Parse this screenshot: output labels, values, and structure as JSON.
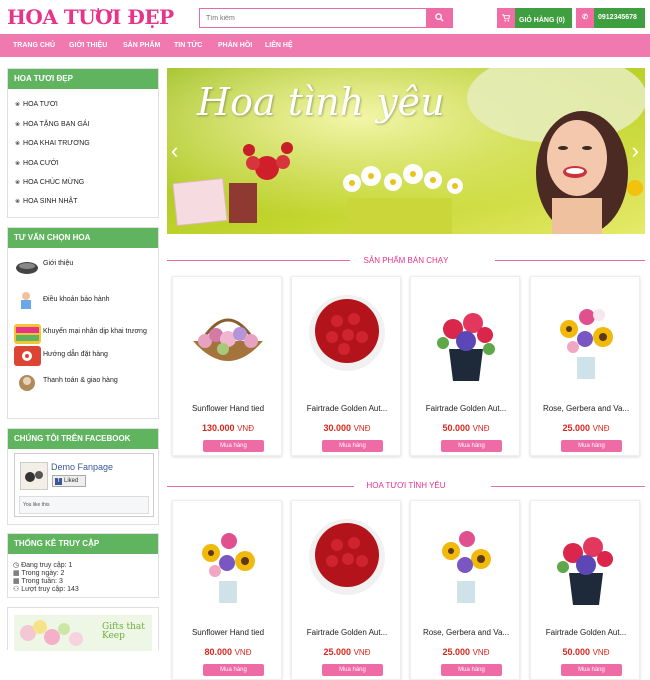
{
  "header": {
    "logo_text": "HOA TƯƠI ĐẸP",
    "search_placeholder": "Tìm kiếm",
    "cart_label": "GIỎ HÀNG (0)",
    "phone": "0912345678"
  },
  "nav": [
    "TRANG CHỦ",
    "GIỚI THIỆU",
    "SẢN PHẨM",
    "TIN TỨC",
    "PHẢN HỒI",
    "LIÊN HỆ"
  ],
  "sidebar": {
    "categories_title": "HOA TƯƠI ĐẸP",
    "categories": [
      "HOA TƯƠI",
      "HOA TẶNG BẠN GÁI",
      "HOA KHAI TRƯƠNG",
      "HOA CƯỚI",
      "HOA CHÚC MỪNG",
      "HOA SINH NHẬT"
    ],
    "advice_title": "TƯ VẤN CHỌN HOA",
    "advice": [
      "Giới thiệu",
      "Điều khoản bảo hành",
      "Khuyến mại nhân dịp khai trương",
      "Hướng dẫn đặt hàng",
      "Thanh toán & giao hàng"
    ],
    "facebook_title": "CHÚNG TÔI TRÊN FACEBOOK",
    "facebook_page": "Demo Fanpage",
    "facebook_liked": "Liked",
    "facebook_like_text": "You like this",
    "stats_title": "THỐNG KÊ TRUY CẬP",
    "stats": [
      "Đang truy cập: 1",
      "Trong ngày: 2",
      "Trong tuần: 3",
      "Lượt truy cập: 143"
    ],
    "banner_text": "Gifts that Keep"
  },
  "slider": {
    "caption": "Hoa tình yêu"
  },
  "sections": [
    {
      "title": "SẢN PHẨM BÁN CHẠY",
      "products": [
        {
          "name": "Sunflower Hand tied",
          "price": "130.000",
          "currency": "VNĐ",
          "buy": "Mua hàng"
        },
        {
          "name": "Fairtrade Golden Aut...",
          "price": "30.000",
          "currency": "VNĐ",
          "buy": "Mua hàng"
        },
        {
          "name": "Fairtrade Golden Aut...",
          "price": "50.000",
          "currency": "VNĐ",
          "buy": "Mua hàng"
        },
        {
          "name": "Rose, Gerbera and Va...",
          "price": "25.000",
          "currency": "VNĐ",
          "buy": "Mua hàng"
        }
      ]
    },
    {
      "title": "HOA TƯƠI TÌNH YÊU",
      "products": [
        {
          "name": "Sunflower Hand tied",
          "price": "80.000",
          "currency": "VNĐ",
          "buy": "Mua hàng"
        },
        {
          "name": "Fairtrade Golden Aut...",
          "price": "25.000",
          "currency": "VNĐ",
          "buy": "Mua hàng"
        },
        {
          "name": "Rose, Gerbera and Va...",
          "price": "25.000",
          "currency": "VNĐ",
          "buy": "Mua hàng"
        },
        {
          "name": "Fairtrade Golden Aut...",
          "price": "50.000",
          "currency": "VNĐ",
          "buy": "Mua hàng"
        }
      ]
    }
  ],
  "colors": {
    "pink": "#f079b0",
    "green": "#60b460",
    "price_red": "#d9261c"
  }
}
